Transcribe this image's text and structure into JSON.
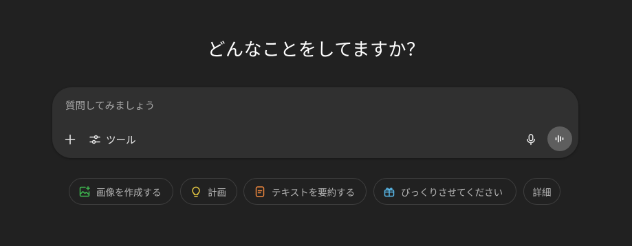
{
  "heading": "どんなことをしてますか？",
  "composer": {
    "placeholder": "質問してみましょう",
    "tools_label": "ツール"
  },
  "chips": [
    {
      "label": "画像を作成する",
      "icon": "image-icon",
      "color": "#3fb950"
    },
    {
      "label": "計画",
      "icon": "lightbulb-icon",
      "color": "#e2c541"
    },
    {
      "label": "テキストを要約する",
      "icon": "document-icon",
      "color": "#f0883e"
    },
    {
      "label": "びっくりさせてください",
      "icon": "gift-icon",
      "color": "#58b6e6"
    },
    {
      "label": "詳細",
      "icon": "",
      "color": ""
    }
  ],
  "colors": {
    "background": "#212121",
    "composer": "#303030",
    "voice_button": "#5e5e5e"
  }
}
